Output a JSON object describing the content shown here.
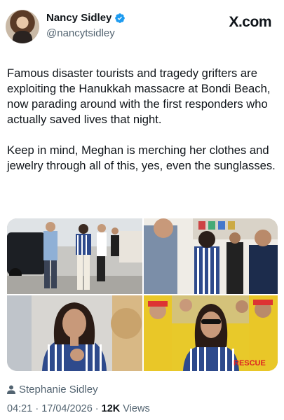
{
  "author": {
    "display_name": "Nancy Sidley",
    "handle": "@nancytsidley",
    "verified": true
  },
  "site_logo": "X.com",
  "tweet": {
    "paragraphs": [
      "Famous disaster tourists and tragedy grifters are exploiting the Hanukkah massacre at Bondi Beach, now parading around with the first responders who actually saved lives that night.",
      "Keep in mind, Meghan is merching her clothes and jewelry through all of this, yes, even the sunglasses."
    ]
  },
  "media": {
    "photos": [
      {
        "label": "group-walking-photo"
      },
      {
        "label": "handshake-photo"
      },
      {
        "label": "portrait-photo"
      },
      {
        "label": "lifeguards-crowd-photo",
        "visible_text": "RESCUE"
      }
    ]
  },
  "attribution": {
    "icon": "person-icon",
    "name": "Stephanie Sidley"
  },
  "meta": {
    "time": "04:21",
    "separator": " · ",
    "date": "17/04/2026",
    "views_count": "12K",
    "views_label": " Views"
  },
  "colors": {
    "verified_blue": "#1d9bf0",
    "secondary_text": "#536471",
    "primary_text": "#0f1419"
  }
}
